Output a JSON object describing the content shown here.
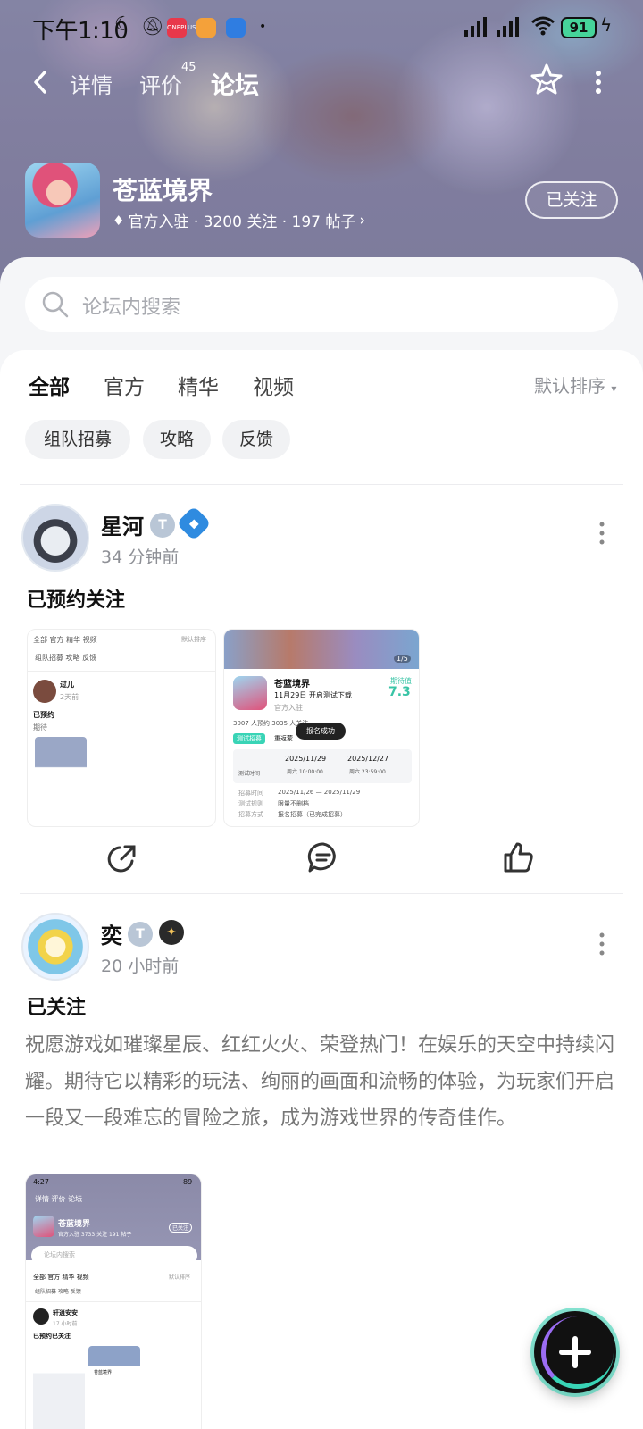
{
  "status_bar": {
    "time": "下午1:10",
    "battery": "91",
    "app1_label": "ONEPLUS"
  },
  "nav": {
    "tabs": [
      {
        "label": "详情"
      },
      {
        "label": "评价"
      },
      {
        "label": "论坛"
      }
    ],
    "review_count": "45",
    "active_tab": "论坛"
  },
  "game": {
    "title": "苍蓝境界",
    "meta": "官方入驻 · 3200 关注 · 197 帖子",
    "follow_label": "已关注"
  },
  "search": {
    "placeholder": "论坛内搜索"
  },
  "filters": {
    "tabs": [
      {
        "label": "全部"
      },
      {
        "label": "官方"
      },
      {
        "label": "精华"
      },
      {
        "label": "视频"
      }
    ],
    "sort_label": "默认排序",
    "chips": [
      {
        "label": "组队招募"
      },
      {
        "label": "攻略"
      },
      {
        "label": "反馈"
      }
    ]
  },
  "posts": [
    {
      "author": "星河",
      "time": "34 分钟前",
      "title": "已预约关注",
      "shot1": {
        "tabs": "全部  官方  精华  视频",
        "sort": "默认排序",
        "chips": "组队招募  攻略  反馈",
        "author": "过儿",
        "time": "2天前",
        "title": "已预约",
        "body": "期待"
      },
      "shot2": {
        "counter": "1/5",
        "title": "苍蓝境界",
        "subtitle": "11月29日 开启测试下载",
        "official": "官方入驻",
        "score_label": "期待值",
        "score": "7.3",
        "stats": "3007 人预约   3035 人关注",
        "tag": "测试招募",
        "tag_text": "重返蒙",
        "toast": "报名成功",
        "test_time_label": "测试时间",
        "start_date": "2025/11/29",
        "start_time": "周六 10:00:00",
        "end_date": "2025/12/27",
        "end_time": "周六 23:59:00",
        "rows": [
          {
            "k": "招募时间",
            "v": "2025/11/26 — 2025/11/29"
          },
          {
            "k": "测试规则",
            "v": "限量不删档"
          },
          {
            "k": "招募方式",
            "v": "报名招募（已完成招募）"
          }
        ]
      }
    },
    {
      "author": "奕",
      "time": "20 小时前",
      "title": "已关注",
      "body": "祝愿游戏如璀璨星辰、红红火火、荣登热门！在娱乐的天空中持续闪耀。期待它以精彩的玩法、绚丽的画面和流畅的体验，为玩家们开启一段又一段难忘的冒险之旅，成为游戏世界的传奇佳作。",
      "shot": {
        "time": "4:27",
        "battery": "89",
        "nav_tabs": "详情   评价   论坛",
        "title": "苍蓝境界",
        "meta": "官方入驻   3733 关注   191 帖子",
        "follow": "已关注",
        "search": "论坛内搜索",
        "tabs": "全部   官方   精华   视频",
        "sort": "默认排序",
        "chips": "组队招募   攻略   反馈",
        "author": "轩逍安安",
        "time2": "17 小时前",
        "post_title": "已预约已关注",
        "game_title": "苍蓝境界"
      }
    }
  ],
  "colors": {
    "accent": "#39d4b6",
    "muted": "#8e9096"
  }
}
